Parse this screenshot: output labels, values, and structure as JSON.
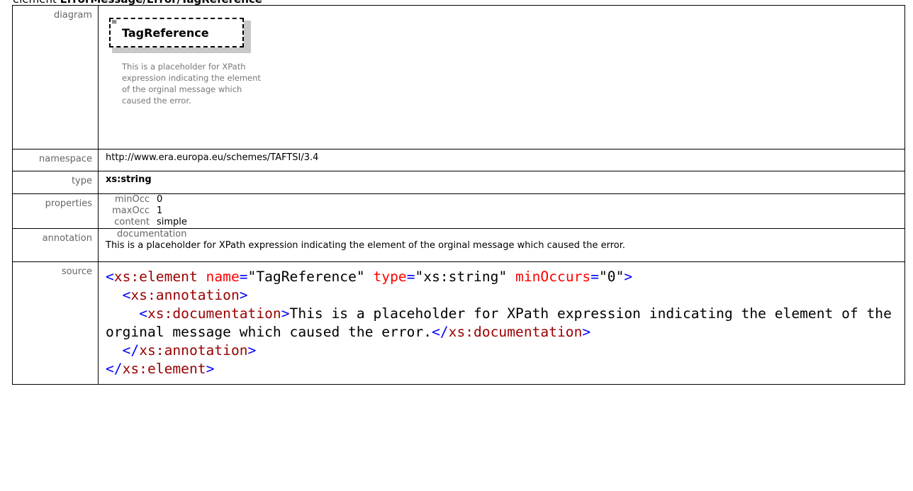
{
  "heading": {
    "keyword": "element",
    "path": "ErrorMessage/Error/TagReference"
  },
  "labels": {
    "diagram": "diagram",
    "namespace": "namespace",
    "type": "type",
    "properties": "properties",
    "annotation": "annotation",
    "source": "source"
  },
  "diagram": {
    "element_name": "TagReference",
    "documentation": "This is a placeholder for XPath expression indicating the element of the orginal message which caused the error."
  },
  "namespace": "http://www.era.europa.eu/schemes/TAFTSI/3.4",
  "type": "xs:string",
  "properties": [
    {
      "key": "minOcc",
      "value": "0"
    },
    {
      "key": "maxOcc",
      "value": "1"
    },
    {
      "key": "content",
      "value": "simple"
    }
  ],
  "annotation": {
    "heading": "documentation",
    "text": "This is a placeholder for XPath expression indicating the element of the orginal message which caused the error."
  },
  "source": {
    "l1_open": "<",
    "l1_tag": "xs:element",
    "l1_a1": " name",
    "l1_eq1": "=",
    "l1_v1": "\"TagReference\"",
    "l1_a2": " type",
    "l1_eq2": "=",
    "l1_v2": "\"xs:string\"",
    "l1_a3": " minOccurs",
    "l1_eq3": "=",
    "l1_v3": "\"0\"",
    "l1_close": ">",
    "l2_open": "<",
    "l2_tag": "xs:annotation",
    "l2_close": ">",
    "l3_open": "<",
    "l3_tag": "xs:documentation",
    "l3_close": ">",
    "l3_text": "This is a placeholder for XPath expression indicating the element of the orginal message which caused the error.",
    "l3_end_open": "</",
    "l3_end_tag": "xs:documentation",
    "l3_end_close": ">",
    "l4_open": "</",
    "l4_tag": "xs:annotation",
    "l4_close": ">",
    "l5_open": "</",
    "l5_tag": "xs:element",
    "l5_close": ">"
  }
}
